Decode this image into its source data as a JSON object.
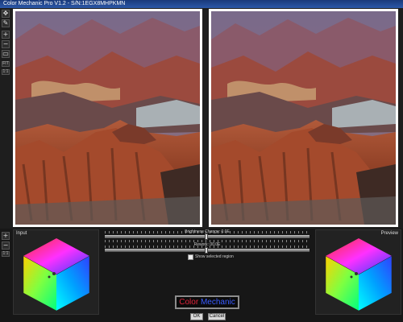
{
  "window": {
    "title": "Color Mechanic Pro V1.2 - S/N:1EGX8MHPKMN"
  },
  "toolbar": {
    "top_tools": [
      {
        "name": "move-tool-icon",
        "glyph": "✥"
      },
      {
        "name": "eyedropper-tool-icon",
        "glyph": "✎"
      },
      {
        "name": "zoom-in-icon",
        "glyph": "+"
      },
      {
        "name": "zoom-out-icon",
        "glyph": "−"
      },
      {
        "name": "fit-view-icon",
        "glyph": "▭"
      },
      {
        "name": "actual-size-icon",
        "glyph": "▣"
      }
    ],
    "fit_label": "FIT",
    "ratio_label": "1:1",
    "cube_zoom_in": "+",
    "cube_zoom_out": "−",
    "cube_ratio": "1:1"
  },
  "panels": {
    "input_label": "Input",
    "preview_label": "Preview"
  },
  "controls": {
    "brightness_label": "Brightness Change: 0.0E",
    "rework_label": "Rework: 00.0E",
    "show_selected_label": "Show selected region",
    "show_selected_checked": false
  },
  "logo": {
    "word1": "Color",
    "word2": "Mechanic",
    "word1_color": "#e0243c",
    "word2_color": "#3a5cff"
  },
  "buttons": {
    "ok": "OK",
    "cancel": "Cancel"
  }
}
